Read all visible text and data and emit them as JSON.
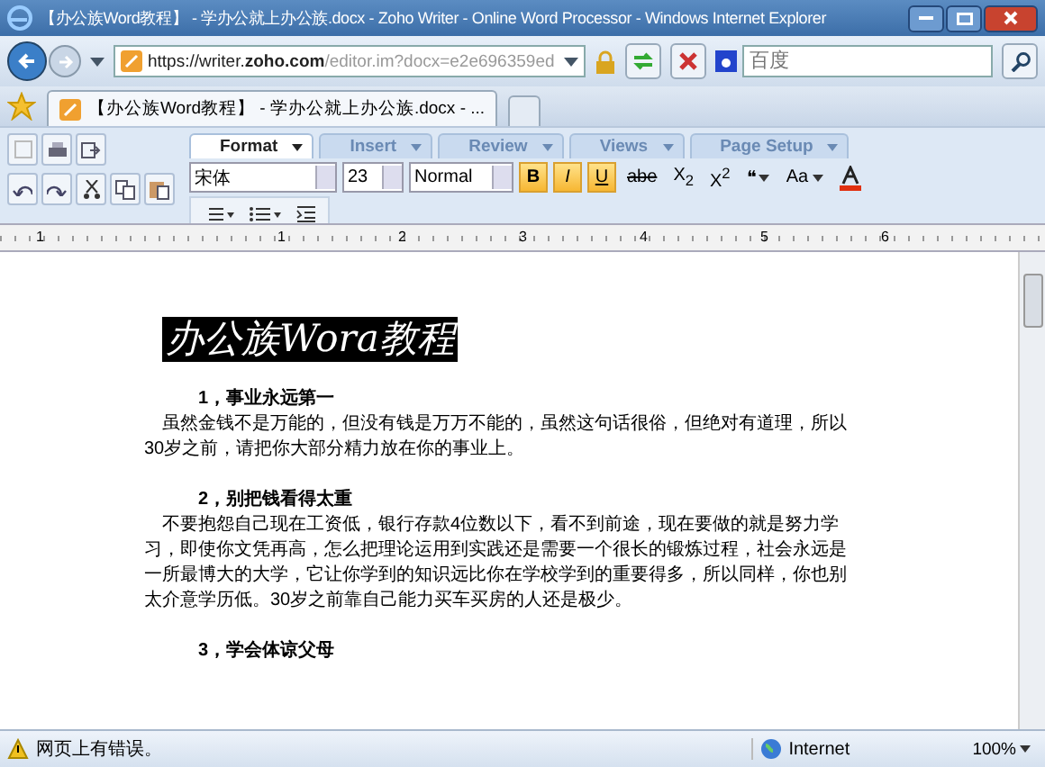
{
  "window": {
    "title": "【办公族Word教程】 - 学办公就上办公族.docx - Zoho Writer - Online Word Processor - Windows Internet Explorer"
  },
  "address_bar": {
    "scheme": "https://writer.",
    "domain": "zoho.com",
    "path": "/editor.im?docx=e2e696359ed"
  },
  "search": {
    "placeholder": "百度"
  },
  "browser_tab": {
    "title": "【办公族Word教程】 - 学办公就上办公族.docx - ..."
  },
  "ribbon_tabs": [
    {
      "label": "Format",
      "selected": true
    },
    {
      "label": "Insert",
      "selected": false
    },
    {
      "label": "Review",
      "selected": false
    },
    {
      "label": "Views",
      "selected": false
    },
    {
      "label": "Page Setup",
      "selected": false
    }
  ],
  "font": {
    "family": "宋体",
    "size": "23",
    "style": "Normal"
  },
  "format_buttons": [
    {
      "kind": "bold",
      "label": "B",
      "on": true
    },
    {
      "kind": "italic",
      "label": "I",
      "on": true
    },
    {
      "kind": "underline",
      "label": "U",
      "on": true
    },
    {
      "kind": "strike",
      "label": "abe",
      "on": false
    },
    {
      "kind": "plain",
      "label": "X$_{2}$",
      "on": false
    },
    {
      "kind": "plain",
      "label": "X$^{2}$",
      "on": false
    },
    {
      "kind": "menu",
      "label": "❝",
      "on": false
    },
    {
      "kind": "menu",
      "label": "Aa",
      "on": false
    }
  ],
  "ruler": [
    "1",
    "1",
    "2",
    "3",
    "4",
    "5",
    "6"
  ],
  "document": {
    "heading": "办公族Wora教程",
    "sections": [
      {
        "title": "1，事业永远第一",
        "body": "虽然金钱不是万能的，但没有钱是万万不能的，虽然这句话很俗，但绝对有道理，所以30岁之前，请把你大部分精力放在你的事业上。"
      },
      {
        "title": "2，别把钱看得太重",
        "body": "不要抱怨自己现在工资低，银行存款4位数以下，看不到前途，现在要做的就是努力学习，即使你文凭再高，怎么把理论运用到实践还是需要一个很长的锻炼过程，社会永远是一所最博大的大学，它让你学到的知识远比你在学校学到的重要得多，所以同样，你也别太介意学历低。30岁之前靠自己能力买车买房的人还是极少。"
      },
      {
        "title": "3，学会体谅父母"
      }
    ]
  },
  "status_bar": {
    "message": "网页上有错误。",
    "zone": "Internet",
    "zoom": "100%"
  }
}
